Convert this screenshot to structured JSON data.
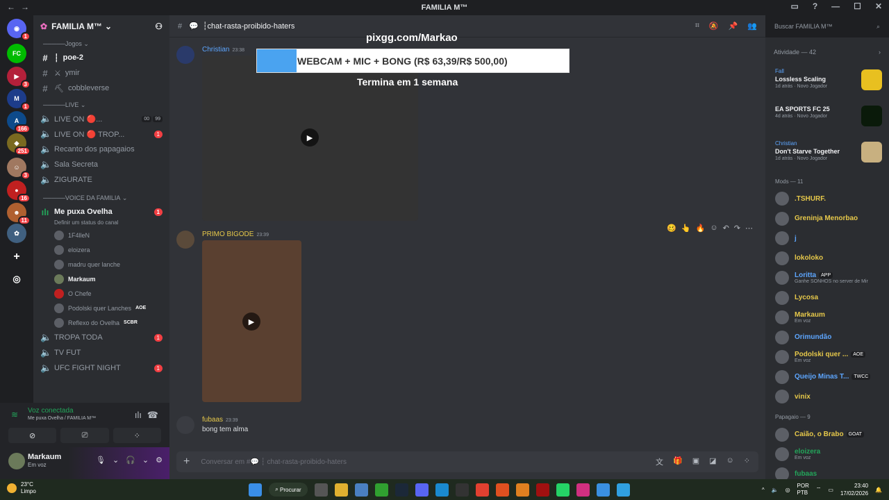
{
  "window": {
    "title": "FAMILIA M™"
  },
  "server": {
    "name": "FAMILIA M™"
  },
  "guild_badges": [
    "1",
    "3",
    "1",
    "1",
    "166",
    "251",
    "3",
    "16",
    "11"
  ],
  "categories": {
    "jogos": "Jogos",
    "live": "LIVE",
    "voice": "VOICE DA FAMILIA"
  },
  "channels_jogos": [
    {
      "name": "poe-2"
    },
    {
      "name": "ymir"
    },
    {
      "name": "cobbleverse"
    }
  ],
  "channels_live": [
    {
      "name": "LIVE ON 🔴...",
      "tags": [
        "00",
        "99"
      ]
    },
    {
      "name": "LIVE ON 🔴 TROP...",
      "badge": "1"
    },
    {
      "name": "Recanto dos papagaios"
    },
    {
      "name": "Sala Secreta"
    },
    {
      "name": "ZIGURATE"
    }
  ],
  "voice_channel": {
    "name": "Me puxa Ovelha",
    "badge": "1",
    "status_placeholder": "Definir um status do canal",
    "users": [
      {
        "name": "1F4lleN"
      },
      {
        "name": "eloizera"
      },
      {
        "name": "madru quer lanche"
      },
      {
        "name": "Markaum"
      },
      {
        "name": "O Chefe"
      },
      {
        "name": "Podolski quer Lanches",
        "tag": "AOE"
      },
      {
        "name": "Reflexo do Ovelha",
        "tag": "SCBR"
      }
    ]
  },
  "channels_after": [
    {
      "name": "TROPA TODA",
      "badge": "1"
    },
    {
      "name": "TV FUT"
    },
    {
      "name": "UFC FIGHT NIGHT",
      "badge": "1"
    }
  ],
  "voice_panel": {
    "title": "Voz conectada",
    "subtitle": "Me puxa Ovelha / FAMILIA M™"
  },
  "user_panel": {
    "name": "Markaum",
    "status": "Em voz"
  },
  "channel": {
    "name": "chat-rasta-proibido-haters"
  },
  "messages": [
    {
      "author": "Christian",
      "time": "23:38",
      "color": "#5da6ff"
    },
    {
      "author": "PRIMO BIGODE",
      "time": "23:39",
      "color": "#e6c84a"
    },
    {
      "author": "fubaas",
      "time": "23:39",
      "color": "#e6c84a",
      "text": "bong tem alma"
    }
  ],
  "overlay": {
    "title": "pixgg.com/Markao",
    "goal_text": "WEBCAM + MIC + BONG (R$ 63,39/R$ 500,00)",
    "goal_progress": 0.127,
    "subtitle": "Termina em 1 semana"
  },
  "composer": {
    "placeholder": "Conversar em #💬 ┆ chat-rasta-proibido-haters"
  },
  "search": {
    "placeholder": "Buscar FAMILIA M™"
  },
  "activity": {
    "header": "Atividade — 42",
    "items": [
      {
        "user": "Fall",
        "game": "Lossless Scaling",
        "time": "1d atrás",
        "tag": "Novo Jogador"
      },
      {
        "user": "",
        "game": "EA SPORTS FC 25",
        "time": "4d atrás",
        "tag": "Novo Jogador"
      },
      {
        "user": "Christian",
        "game": "Don't Starve Together",
        "time": "1d atrás",
        "tag": "Novo Jogador"
      }
    ]
  },
  "mods": {
    "header": "Mods — 11",
    "members": [
      {
        "name": ".TSHURF.",
        "color": "#e6c84a"
      },
      {
        "name": "Greninja Menorbao",
        "color": "#e6c84a"
      },
      {
        "name": "j",
        "color": "#5da6ff"
      },
      {
        "name": "lokoloko",
        "color": "#e6c84a"
      },
      {
        "name": "Loritta",
        "color": "#5da6ff",
        "tag": "APP",
        "sub": "Ganhe SONHOS no server de Mir"
      },
      {
        "name": "Lycosa",
        "color": "#e6c84a"
      },
      {
        "name": "Markaum",
        "color": "#e6c84a",
        "sub": "Em voz"
      },
      {
        "name": "Orimundão",
        "color": "#5da6ff"
      },
      {
        "name": "Podolski quer ...",
        "color": "#e6c84a",
        "tag": "AOE",
        "sub": "Em voz"
      },
      {
        "name": "Queijo Minas T...",
        "color": "#5da6ff",
        "tag": "TWCC"
      },
      {
        "name": "vinix",
        "color": "#e6c84a"
      }
    ]
  },
  "papagaio": {
    "header": "Papagaio — 9",
    "members": [
      {
        "name": "Caião, o Brabo",
        "color": "#e6c84a",
        "tag": "GOAT"
      },
      {
        "name": "eloizera",
        "color": "#23a55a",
        "sub": "Em voz"
      },
      {
        "name": "fubaas",
        "color": "#23a55a"
      }
    ]
  },
  "taskbar": {
    "temp": "23°C",
    "weather": "Limpo",
    "search": "Procurar",
    "lang": "POR",
    "layout": "PTB",
    "time": "23:40",
    "date": "17/02/2026"
  }
}
